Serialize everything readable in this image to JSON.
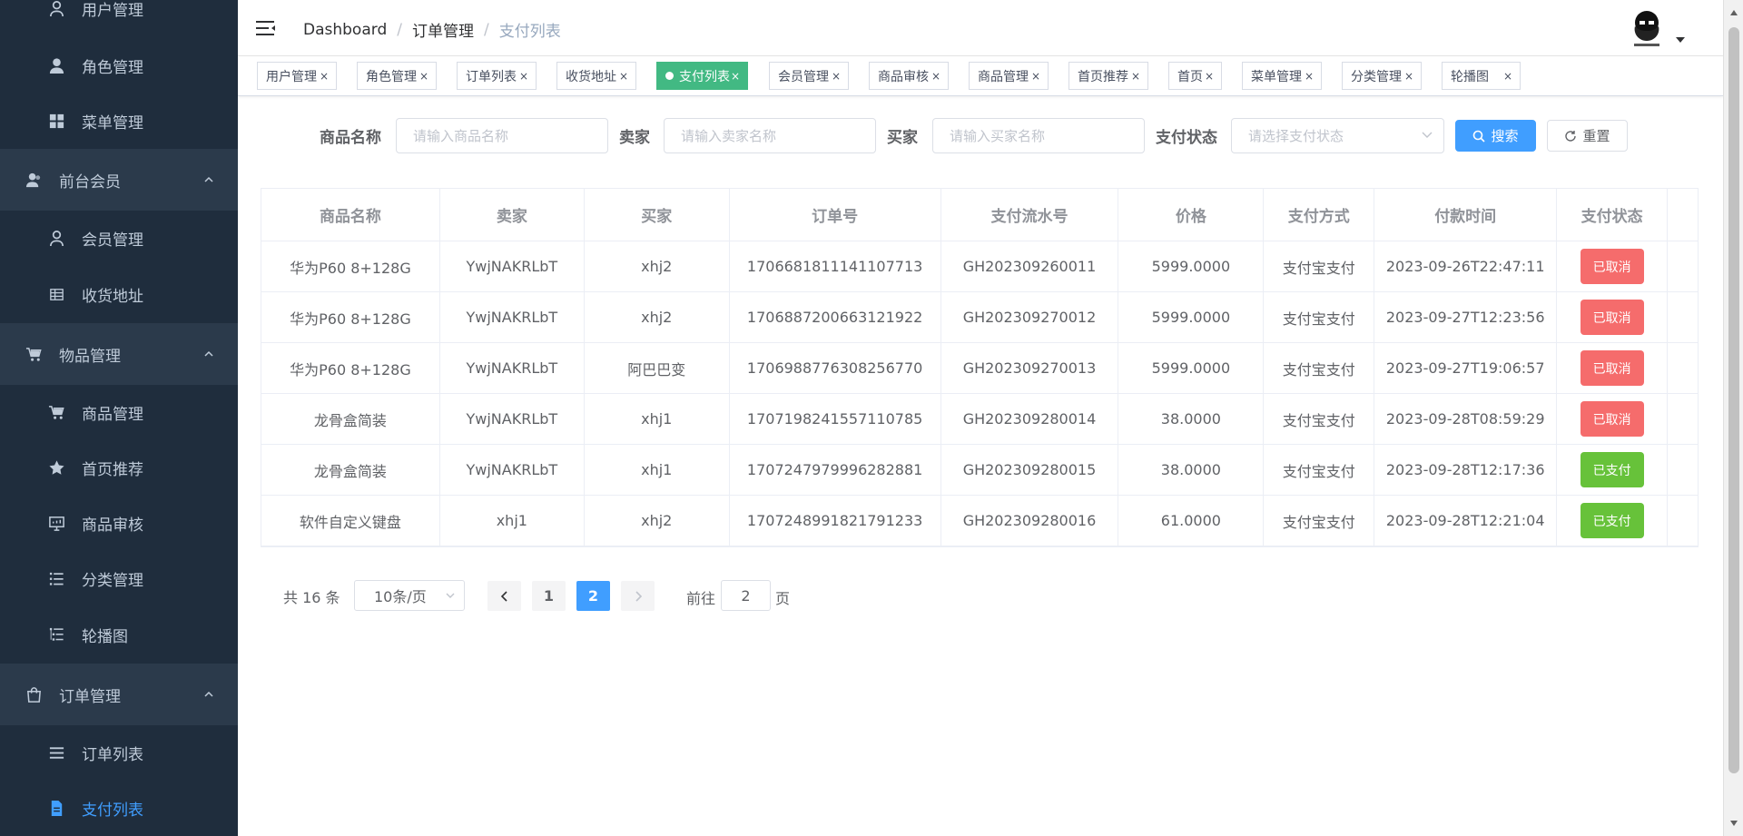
{
  "sidebar": {
    "items": [
      {
        "label": "用户管理",
        "icon": "user-icon"
      },
      {
        "label": "角色管理",
        "icon": "user-filled-icon"
      },
      {
        "label": "菜单管理",
        "icon": "grid-icon"
      },
      {
        "label": "前台会员",
        "icon": "members-icon"
      },
      {
        "label": "会员管理",
        "icon": "user-icon"
      },
      {
        "label": "收货地址",
        "icon": "table-icon"
      },
      {
        "label": "物品管理",
        "icon": "cart-icon"
      },
      {
        "label": "商品管理",
        "icon": "cart-icon"
      },
      {
        "label": "首页推荐",
        "icon": "star-icon"
      },
      {
        "label": "商品审核",
        "icon": "monitor-icon"
      },
      {
        "label": "分类管理",
        "icon": "list-icon"
      },
      {
        "label": "轮播图",
        "icon": "tree-list-icon"
      },
      {
        "label": "订单管理",
        "icon": "shopping-bag-icon"
      },
      {
        "label": "订单列表",
        "icon": "lines-icon"
      },
      {
        "label": "支付列表",
        "icon": "document-icon"
      }
    ]
  },
  "navbar": {
    "breadcrumb": [
      "Dashboard",
      "订单管理",
      "支付列表"
    ],
    "separator": "/"
  },
  "tags": [
    {
      "label": "用户管理",
      "active": false
    },
    {
      "label": "角色管理",
      "active": false
    },
    {
      "label": "订单列表",
      "active": false
    },
    {
      "label": "收货地址",
      "active": false
    },
    {
      "label": "支付列表",
      "active": true
    },
    {
      "label": "会员管理",
      "active": false
    },
    {
      "label": "商品审核",
      "active": false
    },
    {
      "label": "商品管理",
      "active": false
    },
    {
      "label": "首页推荐",
      "active": false
    },
    {
      "label": "首页",
      "active": false
    },
    {
      "label": "菜单管理",
      "active": false
    },
    {
      "label": "分类管理",
      "active": false
    },
    {
      "label": "轮播图",
      "active": false
    }
  ],
  "tag_close": "×",
  "filters": {
    "product_label": "商品名称",
    "product_placeholder": "请输入商品名称",
    "seller_label": "卖家",
    "seller_placeholder": "请输入卖家名称",
    "buyer_label": "买家",
    "buyer_placeholder": "请输入买家名称",
    "status_label": "支付状态",
    "status_placeholder": "请选择支付状态",
    "search_button": "搜索",
    "reset_button": "重置"
  },
  "table": {
    "columns": [
      "商品名称",
      "卖家",
      "买家",
      "订单号",
      "支付流水号",
      "价格",
      "支付方式",
      "付款时间",
      "支付状态"
    ],
    "rows": [
      {
        "product": "华为P60 8+128G",
        "seller": "YwjNAKRLbT",
        "buyer": "xhj2",
        "order_no": "1706681811141107713",
        "serial_no": "GH202309260011",
        "price": "5999.0000",
        "method": "支付宝支付",
        "paid_at": "2023-09-26T22:47:11",
        "status": "已取消",
        "status_type": "cancel"
      },
      {
        "product": "华为P60 8+128G",
        "seller": "YwjNAKRLbT",
        "buyer": "xhj2",
        "order_no": "1706887200663121922",
        "serial_no": "GH202309270012",
        "price": "5999.0000",
        "method": "支付宝支付",
        "paid_at": "2023-09-27T12:23:56",
        "status": "已取消",
        "status_type": "cancel"
      },
      {
        "product": "华为P60 8+128G",
        "seller": "YwjNAKRLbT",
        "buyer": "阿巴巴变",
        "order_no": "1706988776308256770",
        "serial_no": "GH202309270013",
        "price": "5999.0000",
        "method": "支付宝支付",
        "paid_at": "2023-09-27T19:06:57",
        "status": "已取消",
        "status_type": "cancel"
      },
      {
        "product": "龙骨盒简装",
        "seller": "YwjNAKRLbT",
        "buyer": "xhj1",
        "order_no": "1707198241557110785",
        "serial_no": "GH202309280014",
        "price": "38.0000",
        "method": "支付宝支付",
        "paid_at": "2023-09-28T08:59:29",
        "status": "已取消",
        "status_type": "cancel"
      },
      {
        "product": "龙骨盒简装",
        "seller": "YwjNAKRLbT",
        "buyer": "xhj1",
        "order_no": "1707247979996282881",
        "serial_no": "GH202309280015",
        "price": "38.0000",
        "method": "支付宝支付",
        "paid_at": "2023-09-28T12:17:36",
        "status": "已支付",
        "status_type": "paid"
      },
      {
        "product": "软件自定义键盘",
        "seller": "xhj1",
        "buyer": "xhj2",
        "order_no": "1707248991821791233",
        "serial_no": "GH202309280016",
        "price": "61.0000",
        "method": "支付宝支付",
        "paid_at": "2023-09-28T12:21:04",
        "status": "已支付",
        "status_type": "paid"
      }
    ]
  },
  "pagination": {
    "total": "共 16 条",
    "page_size": "10条/页",
    "pages": [
      "1",
      "2"
    ],
    "current": "2",
    "goto_label": "前往",
    "goto_value": "2",
    "goto_suffix": "页"
  },
  "colors": {
    "sidebar_bg": "#1f2d3d",
    "sidebar_group_bg": "#2b3a4b",
    "active_tag": "#42b983",
    "primary": "#409eff",
    "danger": "#f56c6c",
    "success": "#67c23a"
  }
}
